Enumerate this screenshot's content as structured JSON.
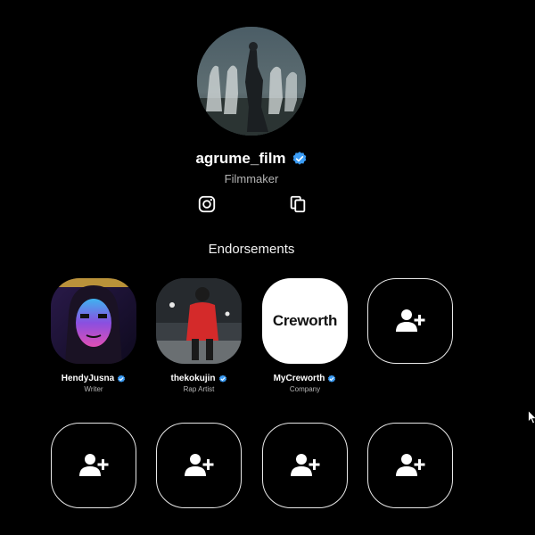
{
  "profile": {
    "username": "agrume_film",
    "role": "Filmmaker",
    "verified": true
  },
  "icons": {
    "instagram": "instagram-icon",
    "copy": "copy-icon",
    "verified": "verified-badge-icon",
    "add_person": "add-person-icon"
  },
  "colors": {
    "background": "#000000",
    "verified_blue": "#3b9cf5",
    "subtext": "#b5b5b5"
  },
  "endorsements": {
    "title": "Endorsements",
    "items": [
      {
        "name": "HendyJusna",
        "role": "Writer",
        "verified": true
      },
      {
        "name": "thekokujin",
        "role": "Rap Artist",
        "verified": true
      },
      {
        "name": "MyCreworth",
        "role": "Company",
        "verified": true,
        "logo_text": "Creworth"
      }
    ],
    "empty_slots": 5
  }
}
